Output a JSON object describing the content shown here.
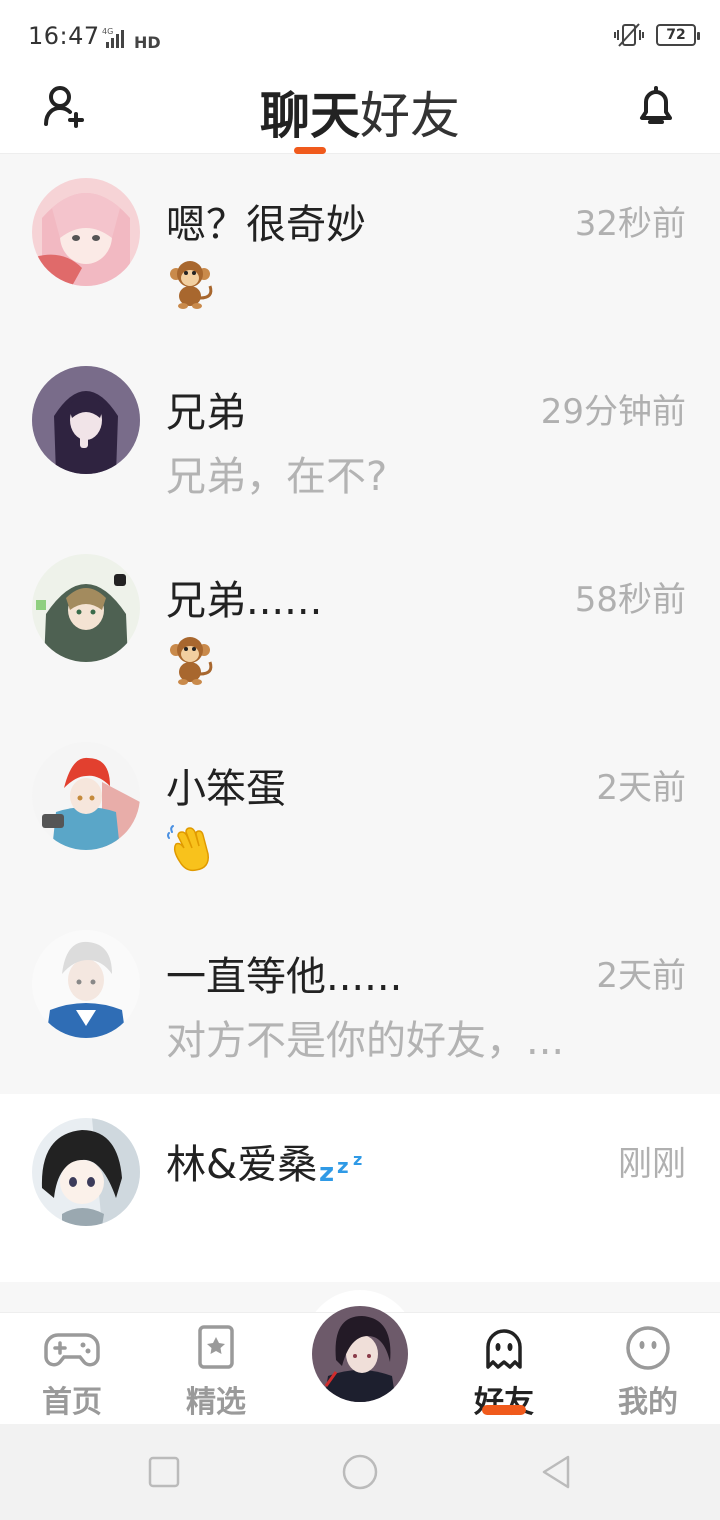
{
  "status_bar": {
    "time": "16:47",
    "network": "4G",
    "hd": "HD",
    "battery": "72"
  },
  "header": {
    "title_chat": "聊天",
    "title_friends": "好友",
    "add_friend_icon": "add-friend-icon",
    "bell_icon": "bell-icon",
    "accent_color": "#f05a1c"
  },
  "conversations": [
    {
      "name": "嗯？很奇妙",
      "time": "32秒前",
      "preview": "",
      "emoji": "monkey"
    },
    {
      "name": "兄弟",
      "time": "29分钟前",
      "preview": "兄弟，在不?",
      "emoji": ""
    },
    {
      "name": "兄弟......",
      "time": "58秒前",
      "preview": "",
      "emoji": "monkey"
    },
    {
      "name": "小笨蛋",
      "time": "2天前",
      "preview": "",
      "emoji": "waving-hand"
    },
    {
      "name": "一直等他......",
      "time": "2天前",
      "preview": "对方不是你的好友，...",
      "emoji": ""
    },
    {
      "name": "林&爱桑",
      "time": "刚刚",
      "preview": "",
      "emoji": "",
      "name_suffix_icon": "sleeping-zzz"
    }
  ],
  "bottom_nav": {
    "items": [
      {
        "label": "首页",
        "icon": "gamepad-icon"
      },
      {
        "label": "精选",
        "icon": "bookmark-star-icon"
      },
      {
        "label": "",
        "icon": "center-avatar"
      },
      {
        "label": "好友",
        "icon": "ghost-icon"
      },
      {
        "label": "我的",
        "icon": "smiley-icon"
      }
    ],
    "active": "好友"
  }
}
